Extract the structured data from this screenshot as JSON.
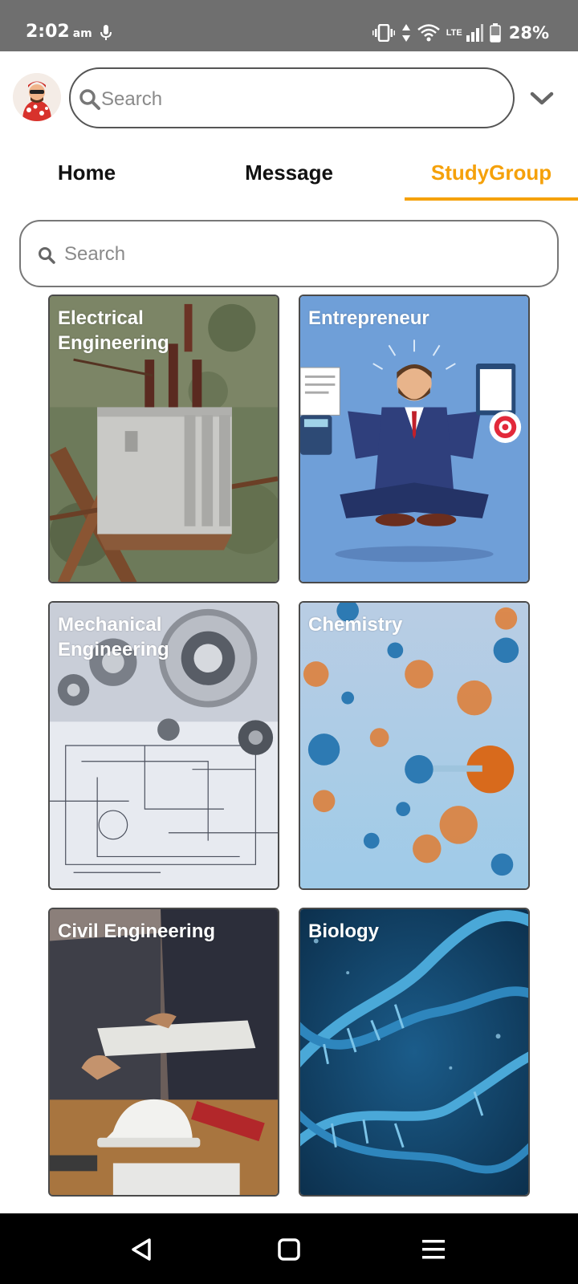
{
  "status": {
    "time": "2:02",
    "ampm": "am",
    "network": "LTE",
    "battery": "28%",
    "icons": [
      "mic-icon",
      "vibrate-icon",
      "data-arrows-icon",
      "wifi-icon",
      "signal-icon",
      "battery-icon"
    ]
  },
  "header": {
    "search_placeholder": "Search",
    "dropdown_icon": "chevron-down-icon"
  },
  "tabs": [
    {
      "label": "Home",
      "active": false
    },
    {
      "label": "Message",
      "active": false
    },
    {
      "label": "StudyGroup",
      "active": true
    }
  ],
  "group_search": {
    "placeholder": "Search"
  },
  "groups": [
    {
      "title": "Electrical Engineering",
      "image": "transformer-photo"
    },
    {
      "title": "Entrepreneur",
      "image": "multitasking-businessman-illustration"
    },
    {
      "title": "Mechanical Engineering",
      "image": "gears-on-blueprint-photo"
    },
    {
      "title": "Chemistry",
      "image": "molecules-photo"
    },
    {
      "title": "Civil Engineering",
      "image": "construction-plans-photo"
    },
    {
      "title": "Biology",
      "image": "dna-helix-photo"
    }
  ],
  "colors": {
    "accent": "#f5a10a",
    "status_bar": "#6f6f6f",
    "nav_bar": "#000000"
  },
  "nav": {
    "icons": [
      "back-icon",
      "home-icon",
      "menu-icon"
    ]
  }
}
